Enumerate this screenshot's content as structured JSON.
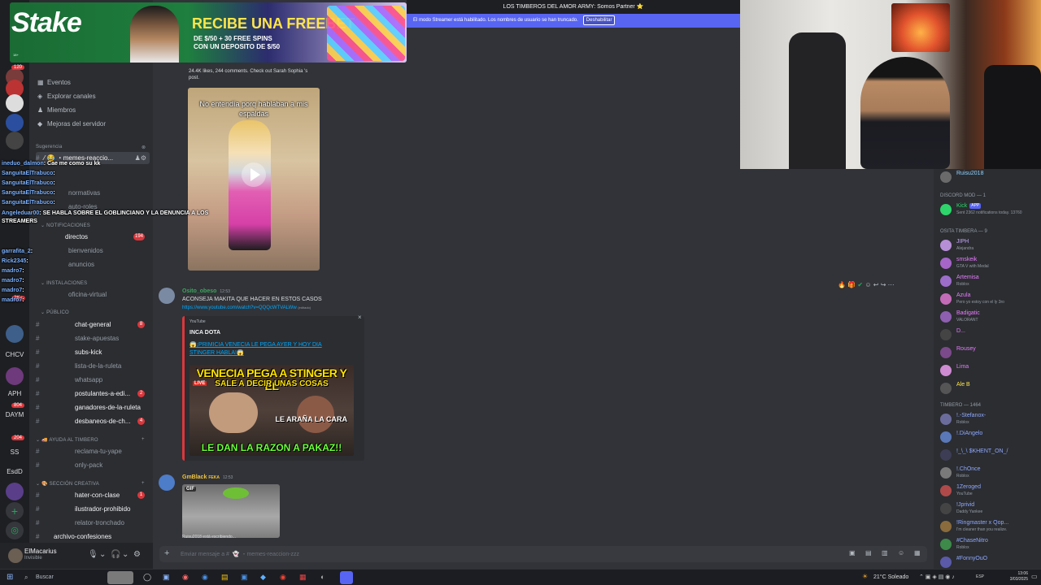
{
  "top_banner": {
    "title": "LOS TIMBEROS DEL AMOR ARMY: Somos Partner ⭐",
    "streamer_notice": "El modo Streamer está habilitado. Los nombres de usuario se han truncado.",
    "disable_button": "Deshabilitar"
  },
  "ad": {
    "brand": "Stake",
    "headline": "RECIBE UNA FREEBET",
    "subline1": "DE $/50 + 30 FREE SPINS",
    "subline2": "CON UN DEPOSITO DE $/50",
    "fine_print": "18+"
  },
  "rail": {
    "labels": [
      "CHCV",
      "APH",
      "DAYM",
      "EsdD",
      "SS"
    ],
    "badges": [
      "120",
      "2K+",
      "804",
      "204"
    ]
  },
  "sidebar": {
    "menu": [
      {
        "icon": "calendar-icon",
        "label": "Eventos"
      },
      {
        "icon": "compass-icon",
        "label": "Explorar canales"
      },
      {
        "icon": "members-icon",
        "label": "Miembros"
      },
      {
        "icon": "boost-icon",
        "label": "Mejoras del servidor"
      }
    ],
    "section_suggestion": "Sugerencia",
    "selected_channel": "memes-reaccio...",
    "channels_top": [
      {
        "label": "normativas"
      },
      {
        "label": "auto-roles"
      }
    ],
    "cat_notifications": "NOTIFICACIONES",
    "notif_channels": [
      {
        "label": "directos",
        "badge": "194",
        "bright": true
      },
      {
        "label": "bienvenidos",
        "badge": "",
        "bright": false
      },
      {
        "label": "anuncios",
        "badge": "",
        "bright": false
      }
    ],
    "cat_installations": "INSTALACIONES",
    "install_channels": [
      {
        "label": "oficina-virtual"
      }
    ],
    "cat_public": "PÚBLICO",
    "public_channels": [
      {
        "label": "chat-general",
        "badge": "8",
        "bright": true
      },
      {
        "label": "stake-apuestas",
        "badge": "",
        "bright": false
      },
      {
        "label": "subs-kick",
        "badge": "",
        "bright": true
      },
      {
        "label": "lista-de-la-ruleta",
        "badge": "",
        "bright": false
      },
      {
        "label": "whatsapp",
        "badge": "",
        "bright": false
      },
      {
        "label": "postulantes-a-edi...",
        "badge": "2",
        "bright": true
      },
      {
        "label": "ganadores-de-la-ruleta",
        "badge": "",
        "bright": true
      },
      {
        "label": "desbaneos-de-ch...",
        "badge": "4",
        "bright": true
      }
    ],
    "cat_help": "AYUDA AL TIMBERO",
    "help_channels": [
      {
        "label": "reclama-tu-yape"
      },
      {
        "label": "only-pack"
      }
    ],
    "cat_creative": "SECCIÓN CREATIVA",
    "creative_channels": [
      {
        "label": "hater-con-clase",
        "badge": "1",
        "bright": true
      },
      {
        "label": "ilustrador-prohibido",
        "badge": "",
        "bright": true
      },
      {
        "label": "relator-tronchado",
        "badge": "",
        "bright": false
      },
      {
        "label": "archivo-confesiones",
        "badge": "",
        "bright": true
      }
    ]
  },
  "user_panel": {
    "name": "ElMacarius",
    "status": "Invisible"
  },
  "stream_chat": [
    {
      "name": "ineduo_dalmon",
      "text": ": Cae me como su kk"
    },
    {
      "name": "SanguitaElTrabuco",
      "text": ":"
    },
    {
      "name": "SanguitaElTrabuco",
      "text": ":"
    },
    {
      "name": "SanguitaElTrabuco",
      "text": ":"
    },
    {
      "name": "SanguitaElTrabuco",
      "text": ":"
    },
    {
      "name": "Angeleduar00",
      "text": ": SE HABLA SOBRE EL GOBLINCIANO Y LA DENUNCIA A LOS"
    },
    {
      "name": "",
      "text": "STREAMERS"
    },
    {
      "name": "garrafita_2",
      "text": ":"
    },
    {
      "name": "Rick2345",
      "text": ":"
    },
    {
      "name": "madro7",
      "text": ":"
    },
    {
      "name": "madro7",
      "text": ":"
    },
    {
      "name": "madro7",
      "text": ":"
    },
    {
      "name": "madro7",
      "text": ":"
    }
  ],
  "messages": {
    "post_caption": "24.4K likes, 244 comments. Check out Sarah Sophia 's post.",
    "video_caption": "No entendía porq hablaban a mis espaldas",
    "msg2": {
      "author": "Osito_obeso",
      "time": "12:53",
      "text": "ACONSEJA MAKITA QUE HACER EN ESTOS CASOS",
      "link": "https://www.youtube.com/watch?v=QQQcWTVALWw",
      "edited": "(editado)"
    },
    "embed": {
      "provider": "YouTube",
      "author": "INCA DOTA",
      "title": "😱¡PRIMICIA VENECIA LE PEGA AYER Y HOY DIA STINGER HABLA!😱",
      "thumb_line1": "VENECIA PEGA A STINGER Y EL",
      "thumb_line2": "SALE A DECIR UNAS COSAS",
      "thumb_badge": "LIVE",
      "thumb_overlay": "LE ARAÑA LA CARA",
      "thumb_bottom": "LE DAN LA RAZON A PAKAZ!!"
    },
    "msg3": {
      "author": "GmBlack",
      "badge": "FEKA",
      "time": "12:53",
      "gif_label": "GIF"
    },
    "typing": "Ruisu2018 está escribiendo..."
  },
  "composer": {
    "placeholder": "Enviar mensaje a #  👻 ・memes-reaccion-zzz"
  },
  "members": {
    "top": [
      {
        "name": "Ruisu2018",
        "color": "#8fd3ff"
      }
    ],
    "group1": "DISCORD MOD — 1",
    "group1_members": [
      {
        "name": "Kick",
        "tag": "APP",
        "status": "Sent 2362 notifications today. 13760",
        "color": "#2dd56b"
      }
    ],
    "group2": "OSITA TIMBERA — 9",
    "group2_members": [
      {
        "name": "JIPH",
        "status": "Alejandra",
        "color": "#c9a7ff"
      },
      {
        "name": "smskeik",
        "status": "GTA V with Medal",
        "color": "#e87bff"
      },
      {
        "name": "Artemisa",
        "status": "Roblox",
        "color": "#e87bff"
      },
      {
        "name": "Azula",
        "status": "Pero yo estoy con el ly 3ro",
        "color": "#e87bff"
      },
      {
        "name": "Badigatic",
        "status": "VALORANT",
        "color": "#e87bff"
      },
      {
        "name": "D...",
        "status": "",
        "color": "#e87bff"
      },
      {
        "name": "Rousey",
        "status": "",
        "color": "#e87bff"
      },
      {
        "name": "Lima",
        "status": "",
        "color": "#e87bff"
      },
      {
        "name": "Ale B",
        "status": "",
        "color": "#ffe54a"
      }
    ],
    "group3": "TIMBERO — 1464",
    "group3_members": [
      {
        "name": "!.-Stefanox-",
        "status": "Roblox",
        "color": "#8fa8ff"
      },
      {
        "name": "!.DiAngelo",
        "status": "",
        "color": "#8fa8ff"
      },
      {
        "name": "!_\\_\\ $KHENT_ON_/",
        "status": "",
        "color": "#8fa8ff"
      },
      {
        "name": "!.ChOnce",
        "status": "Roblox",
        "color": "#8fa8ff"
      },
      {
        "name": "1Zeroged",
        "status": "YouTube",
        "color": "#8fa8ff"
      },
      {
        "name": "!Jprivid",
        "status": "Daddy Yankee",
        "color": "#8fa8ff"
      },
      {
        "name": "!Ringmaster x Qop...",
        "status": "I'm cleaner than you realize.",
        "color": "#8fa8ff"
      },
      {
        "name": "#ChaseNitro",
        "status": "Roblox",
        "color": "#8fa8ff"
      },
      {
        "name": "#FonnyOuO",
        "status": "",
        "color": "#8fa8ff"
      }
    ]
  },
  "taskbar": {
    "search": "Buscar",
    "weather": "21°C Soleado",
    "time": "13:06",
    "date": "3/03/2025",
    "lang": "ESP"
  }
}
